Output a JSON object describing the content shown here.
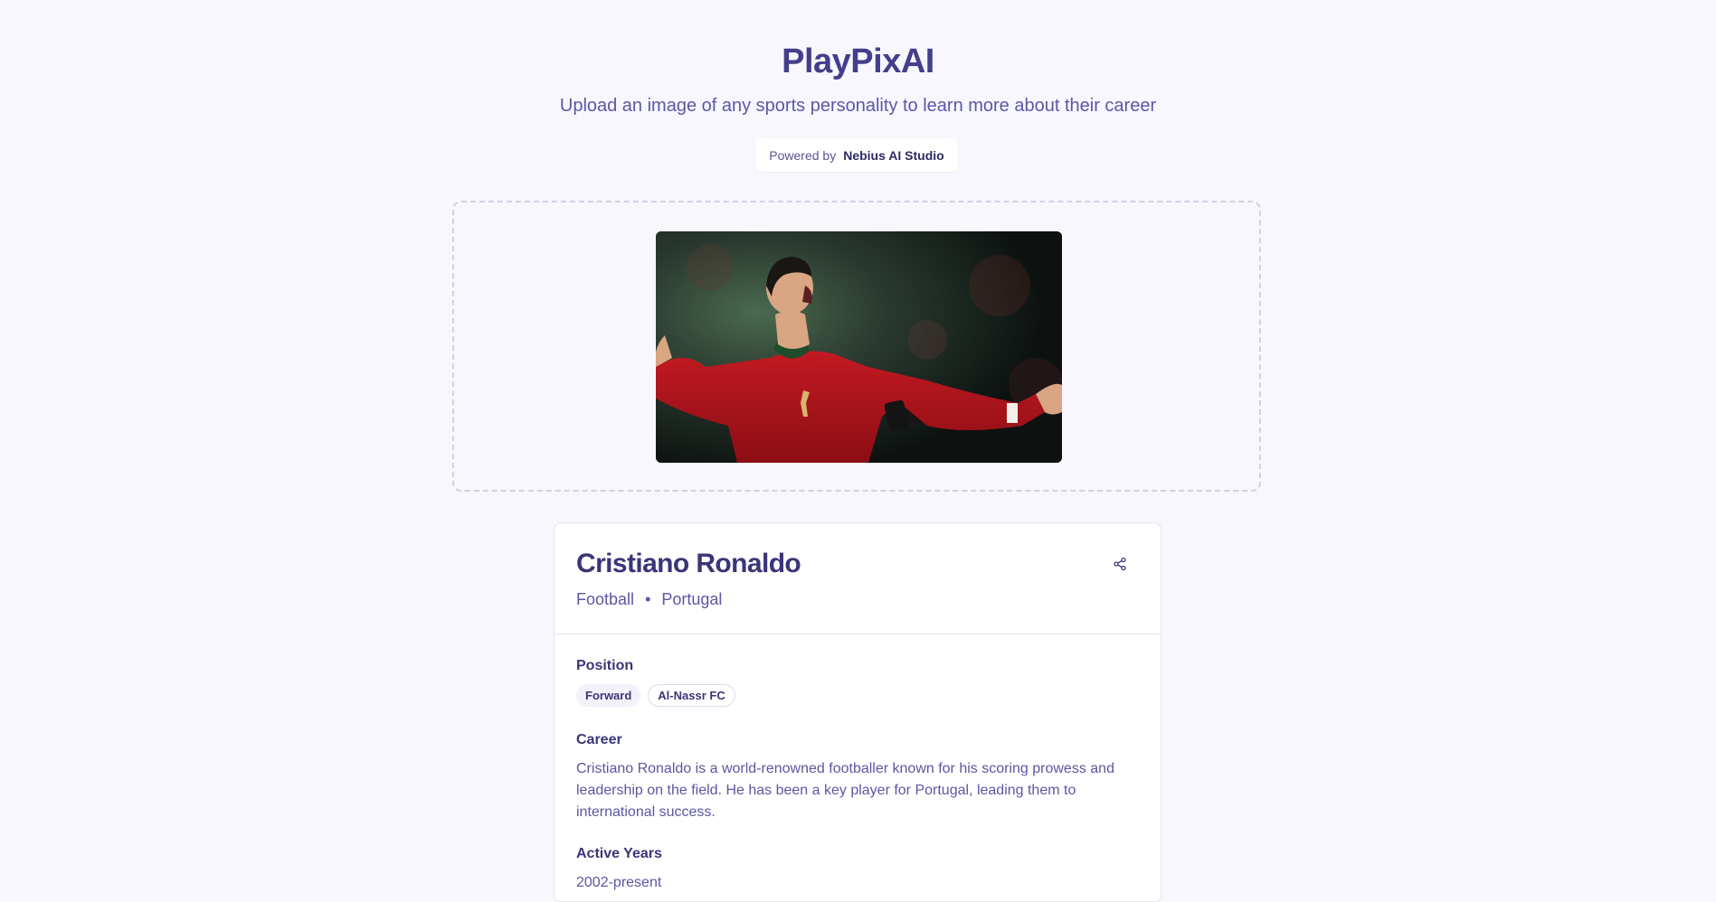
{
  "app": {
    "title": "PlayPixAI",
    "subtitle": "Upload an image of any sports personality to learn more about their career",
    "powered_label": "Powered by",
    "powered_brand": "Nebius AI Studio"
  },
  "upload": {
    "image_description": "uploaded-athlete-photo"
  },
  "result": {
    "name": "Cristiano Ronaldo",
    "sport": "Football",
    "separator": "•",
    "country": "Portugal",
    "share_icon": "share-icon",
    "position_title": "Position",
    "tags": [
      "Forward",
      "Al-Nassr FC"
    ],
    "career_title": "Career",
    "career_text": "Cristiano Ronaldo is a world-renowned footballer known for his scoring prowess and leadership on the field. He has been a key player for Portugal, leading them to international success.",
    "years_title": "Active Years",
    "years_value": "2002-present"
  },
  "colors": {
    "background": "#f7f7fd",
    "accent": "#453e8c",
    "text": "#5c56a3"
  }
}
